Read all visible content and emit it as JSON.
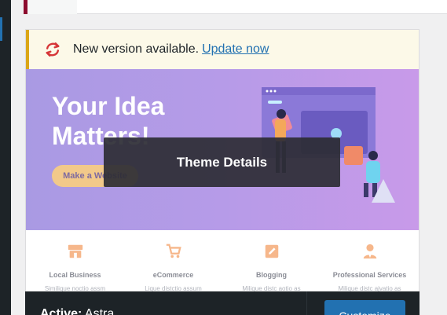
{
  "notice": {
    "message": "New version available.",
    "link": "Update now"
  },
  "preview": {
    "headline": "Your Idea Matters!",
    "cta": "Make a Website",
    "services": [
      {
        "title": "Local Business",
        "sub": "Similique noctio assm",
        "icon": "store-icon"
      },
      {
        "title": "eCommerce",
        "sub": "Lique distctio assum",
        "icon": "cart-icon"
      },
      {
        "title": "Blogging",
        "sub": "Milique distc aotio as",
        "icon": "edit-icon"
      },
      {
        "title": "Professional Services",
        "sub": "Milique distc ajvatio as",
        "icon": "professional-icon"
      }
    ]
  },
  "overlay": {
    "label": "Theme Details"
  },
  "footer": {
    "active_prefix": "Active:",
    "theme_name": "Astra",
    "customize": "Customize"
  },
  "colors": {
    "notice_bg": "#fcf9e8",
    "notice_border": "#dba617",
    "link": "#2271b1",
    "footer_bg": "#1d2327",
    "button": "#2271b1"
  }
}
